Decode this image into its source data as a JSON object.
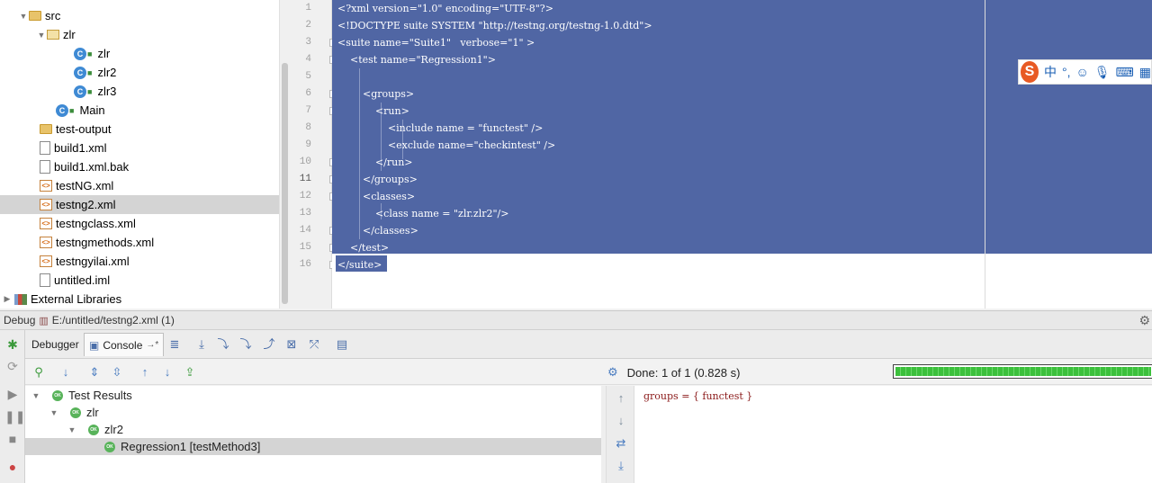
{
  "project_tree": {
    "items": [
      {
        "label": "src",
        "indent": 0
      },
      {
        "label": "zlr",
        "indent": 1
      },
      {
        "label": "zlr",
        "indent": 2
      },
      {
        "label": "zlr2",
        "indent": 2
      },
      {
        "label": "zlr3",
        "indent": 2
      },
      {
        "label": "Main",
        "indent": 1
      },
      {
        "label": "test-output",
        "indent": 0
      },
      {
        "label": "build1.xml",
        "indent": 0
      },
      {
        "label": "build1.xml.bak",
        "indent": 0
      },
      {
        "label": "testNG.xml",
        "indent": 0
      },
      {
        "label": "testng2.xml",
        "indent": 0,
        "selected": true
      },
      {
        "label": "testngclass.xml",
        "indent": 0
      },
      {
        "label": "testngmethods.xml",
        "indent": 0
      },
      {
        "label": "testngyilai.xml",
        "indent": 0
      },
      {
        "label": "untitled.iml",
        "indent": 0
      },
      {
        "label": "External Libraries",
        "indent": 0
      }
    ]
  },
  "editor": {
    "line_numbers": [
      "1",
      "2",
      "3",
      "4",
      "5",
      "6",
      "7",
      "8",
      "9",
      "10",
      "11",
      "12",
      "13",
      "14",
      "15",
      "16"
    ],
    "current_line": "11",
    "lines": [
      "<?xml version=\"1.0\" encoding=\"UTF-8\"?>",
      "<!DOCTYPE suite SYSTEM \"http://testng.org/testng-1.0.dtd\">",
      "<suite name=\"Suite1\"   verbose=\"1\" >",
      "    <test name=\"Regression1\">",
      "",
      "        <groups>",
      "            <run>",
      "                <include name = \"functest\" />",
      "                <exclude name=\"checkintest\" />",
      "            </run>",
      "        </groups>",
      "        <classes>",
      "            <class name = \"zlr.zlr2\"/>",
      "        </classes>",
      "    </test>",
      "</suite>"
    ]
  },
  "ime": {
    "logo": "S",
    "chinese": "中",
    "punct": "°,"
  },
  "debug_panel": {
    "title": "Debug",
    "config": "E:/untitled/testng2.xml (1)",
    "tabs": [
      "Debugger",
      "Console"
    ],
    "tab_suffix": "→*",
    "status_text": "Done: 1 of 1 (0.828 s)",
    "progress": 1.0,
    "results": [
      {
        "label": "Test Results",
        "indent": 0
      },
      {
        "label": "zlr",
        "indent": 1
      },
      {
        "label": "zlr2",
        "indent": 2
      },
      {
        "label": "Regression1 [testMethod3]",
        "indent": 3,
        "selected": true
      }
    ],
    "ok_badge": "OK",
    "console_output": "groups = { functest }"
  },
  "colors": {
    "selection": "#5066a4",
    "pass": "#58b35a",
    "console_text": "#8b1a1a"
  }
}
